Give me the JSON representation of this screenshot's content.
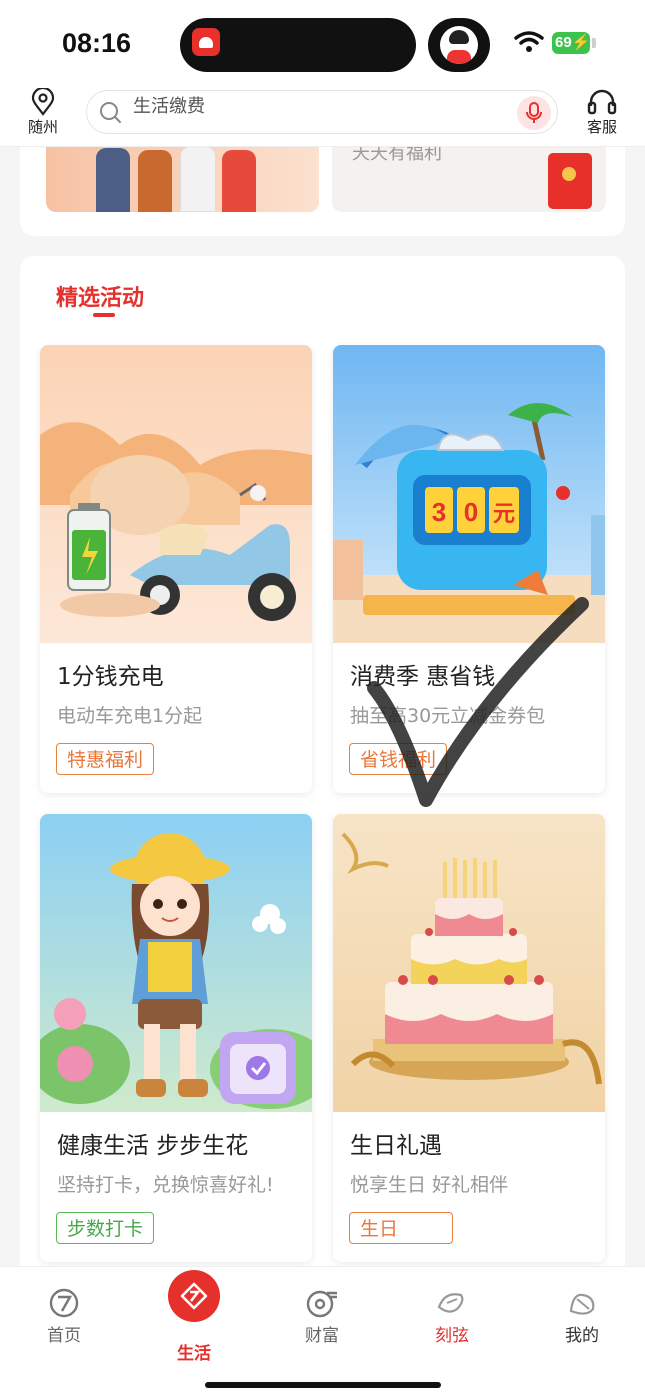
{
  "status_bar": {
    "time": "08:16",
    "battery": "69"
  },
  "header": {
    "location_label": "随州",
    "search_placeholder": "生活缴费",
    "service_label": "客服"
  },
  "top_banner": {
    "right_text": "天天有福利"
  },
  "section": {
    "title": "精选活动",
    "cards": [
      {
        "title": "1分钱充电",
        "subtitle": "电动车充电1分起",
        "tag": "特惠福利"
      },
      {
        "title": "消费季 惠省钱",
        "subtitle": "抽至高30元立减金券包",
        "tag": "省钱福利",
        "image_text": "30元"
      },
      {
        "title": "健康生活 步步生花",
        "subtitle": "坚持打卡，兑换惊喜好礼!",
        "tag": "步数打卡"
      },
      {
        "title": "生日礼遇",
        "subtitle": "悦享生日 好礼相伴",
        "tag": "生日"
      }
    ]
  },
  "bottom_nav": {
    "items": [
      {
        "label": "首页",
        "icon": "home-icon"
      },
      {
        "label": "生活",
        "icon": "life-icon"
      },
      {
        "label": "财富",
        "icon": "wealth-icon"
      },
      {
        "label": "刻弦",
        "icon": "brush-icon"
      },
      {
        "label": "我的",
        "icon": "profile-icon"
      }
    ]
  },
  "colors": {
    "accent": "#e6302b",
    "tag_orange": "#e8783a",
    "tag_green": "#47a84b"
  }
}
